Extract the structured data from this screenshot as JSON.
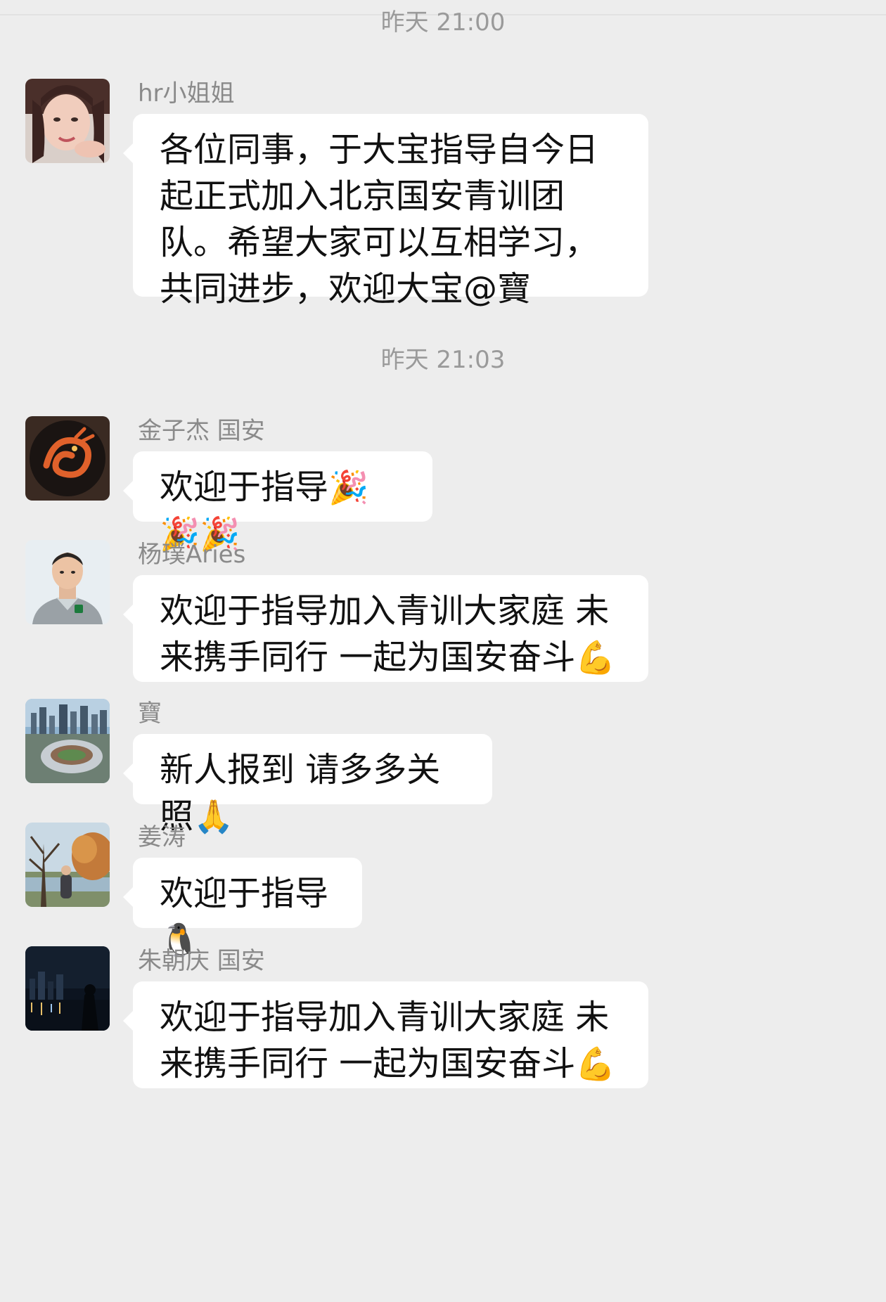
{
  "timestamps": [
    "昨天 21:00",
    "昨天 21:03"
  ],
  "messages": [
    {
      "sender": "hr小姐姐",
      "text": "各位同事，于大宝指导自今日起正式加入北京国安青训团队。希望大家可以互相学习，共同进步，欢迎大宝@寶",
      "emoji": ""
    },
    {
      "sender": "金子杰 国安",
      "text": "欢迎于指导",
      "emoji": "🎉🎉🎉"
    },
    {
      "sender": "杨璞Aries",
      "text": "欢迎于指导加入青训大家庭 未来携手同行 一起为国安奋斗",
      "emoji": "💪"
    },
    {
      "sender": "寶",
      "text": "新人报到 请多多关照",
      "emoji": "🙏"
    },
    {
      "sender": "姜涛",
      "text": "欢迎于指导",
      "emoji": "🐧"
    },
    {
      "sender": "朱朝庆 国安",
      "text": "欢迎于指导加入青训大家庭 未来携手同行 一起为国安奋斗",
      "emoji": "💪"
    }
  ],
  "avatars": [
    {
      "icon": "woman-portrait-avatar-icon"
    },
    {
      "icon": "orange-dragon-avatar-icon"
    },
    {
      "icon": "man-in-sportswear-avatar-icon"
    },
    {
      "icon": "stadium-city-skyline-avatar-icon"
    },
    {
      "icon": "autumn-tree-lake-avatar-icon"
    },
    {
      "icon": "night-city-skyline-avatar-icon"
    }
  ],
  "colors": {
    "background": "#ededed",
    "bubble": "#ffffff",
    "sender": "#8a8a8a",
    "timestamp": "#9a9a9a"
  }
}
